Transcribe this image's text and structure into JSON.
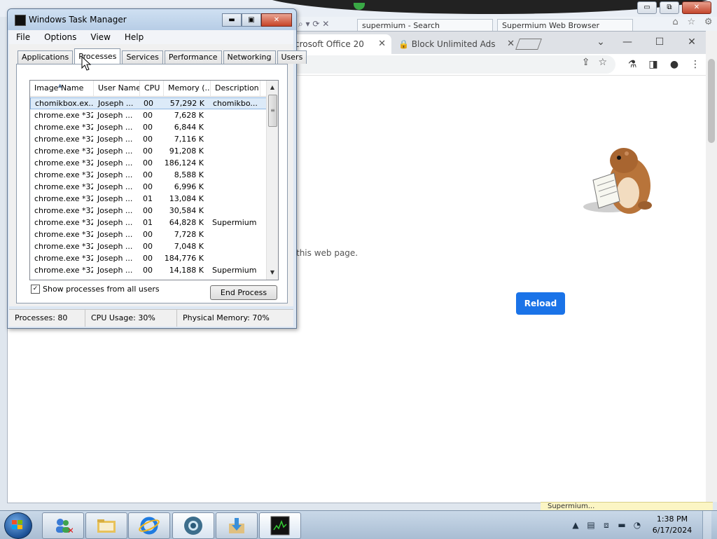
{
  "ie_window": {
    "tabs": [
      "supermium - Search",
      "Supermium Web Browser"
    ],
    "controls": {
      "minimize": "▭",
      "restore": "⧉",
      "close": "✕"
    }
  },
  "browser": {
    "tabs": [
      {
        "label": "crosoft Office 20",
        "close": "✕"
      },
      {
        "label": "Block Unlimited Ads",
        "close": "✕"
      }
    ],
    "window_controls": {
      "minimize": "—",
      "maximize": "☐",
      "close": "✕"
    },
    "error_text": "this web page.",
    "reload_label": "Reload",
    "status_bubble": "Supermium..."
  },
  "task_manager": {
    "title": "Windows Task Manager",
    "controls": {
      "minimize": "▬",
      "maximize": "▣",
      "close": "✕"
    },
    "menu": [
      "File",
      "Options",
      "View",
      "Help"
    ],
    "tabs": [
      "Applications",
      "Processes",
      "Services",
      "Performance",
      "Networking",
      "Users"
    ],
    "active_tab": "Processes",
    "columns": [
      "Image Name",
      "User Name",
      "CPU",
      "Memory (...",
      "Description"
    ],
    "rows": [
      {
        "image": "chomikbox.ex...",
        "user": "Joseph ...",
        "cpu": "00",
        "mem": "57,292 K",
        "desc": "chomikbo..."
      },
      {
        "image": "chrome.exe *32",
        "user": "Joseph ...",
        "cpu": "00",
        "mem": "7,628 K",
        "desc": ""
      },
      {
        "image": "chrome.exe *32",
        "user": "Joseph ...",
        "cpu": "00",
        "mem": "6,844 K",
        "desc": ""
      },
      {
        "image": "chrome.exe *32",
        "user": "Joseph ...",
        "cpu": "00",
        "mem": "7,116 K",
        "desc": ""
      },
      {
        "image": "chrome.exe *32",
        "user": "Joseph ...",
        "cpu": "00",
        "mem": "91,208 K",
        "desc": ""
      },
      {
        "image": "chrome.exe *32",
        "user": "Joseph ...",
        "cpu": "00",
        "mem": "186,124 K",
        "desc": ""
      },
      {
        "image": "chrome.exe *32",
        "user": "Joseph ...",
        "cpu": "00",
        "mem": "8,588 K",
        "desc": ""
      },
      {
        "image": "chrome.exe *32",
        "user": "Joseph ...",
        "cpu": "00",
        "mem": "6,996 K",
        "desc": ""
      },
      {
        "image": "chrome.exe *32",
        "user": "Joseph ...",
        "cpu": "01",
        "mem": "13,084 K",
        "desc": ""
      },
      {
        "image": "chrome.exe *32",
        "user": "Joseph ...",
        "cpu": "00",
        "mem": "30,584 K",
        "desc": ""
      },
      {
        "image": "chrome.exe *32",
        "user": "Joseph ...",
        "cpu": "01",
        "mem": "64,828 K",
        "desc": "Supermium"
      },
      {
        "image": "chrome.exe *32",
        "user": "Joseph ...",
        "cpu": "00",
        "mem": "7,728 K",
        "desc": ""
      },
      {
        "image": "chrome.exe *32",
        "user": "Joseph ...",
        "cpu": "00",
        "mem": "7,048 K",
        "desc": ""
      },
      {
        "image": "chrome.exe *32",
        "user": "Joseph ...",
        "cpu": "00",
        "mem": "184,776 K",
        "desc": ""
      },
      {
        "image": "chrome.exe *32",
        "user": "Joseph ...",
        "cpu": "00",
        "mem": "14,188 K",
        "desc": "Supermium"
      }
    ],
    "show_all_label": "Show processes from all users",
    "show_all_checked": true,
    "end_process_label": "End Process",
    "status": {
      "processes": "Processes: 80",
      "cpu": "CPU Usage: 30%",
      "memory": "Physical Memory: 70%"
    }
  },
  "taskbar": {
    "pinned": [
      "users-icon",
      "explorer-icon",
      "ie-icon",
      "browser-icon",
      "download-icon",
      "task-manager-icon"
    ],
    "clock_time": "1:38 PM",
    "clock_date": "6/17/2024"
  },
  "colors": {
    "reload_blue": "#1a73e8",
    "selection": "#dceaf8",
    "taskbar": "#b8cbe0"
  }
}
